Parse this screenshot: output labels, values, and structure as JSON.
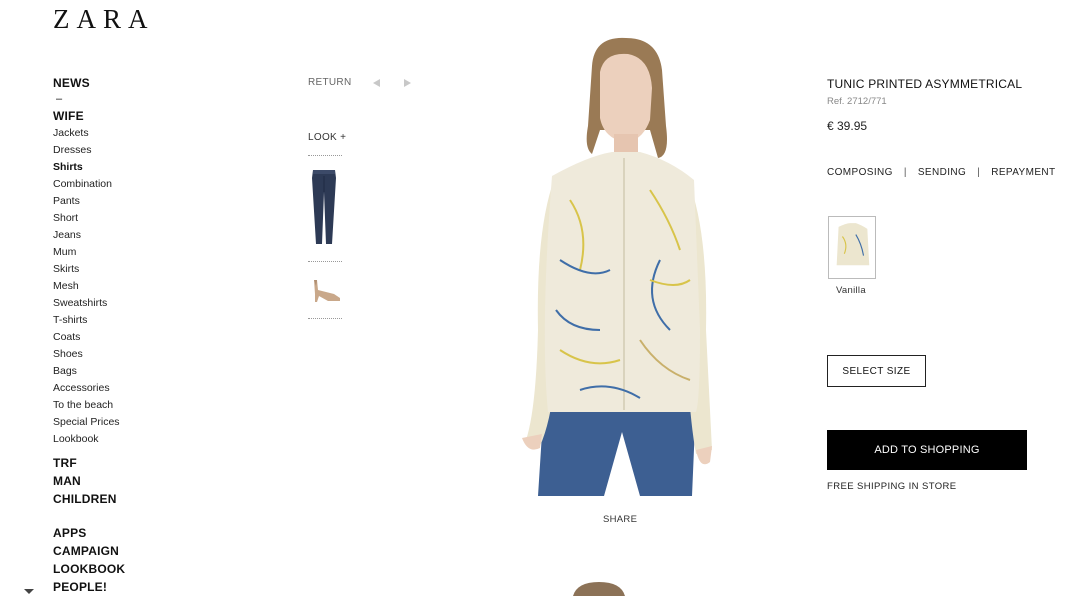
{
  "brand": {
    "logo_text": "ZARA"
  },
  "nav": {
    "news": "NEWS",
    "dash": "–",
    "wife": "WIFE",
    "wife_items": [
      {
        "label": "Jackets",
        "active": false
      },
      {
        "label": "Dresses",
        "active": false
      },
      {
        "label": "Shirts",
        "active": true
      },
      {
        "label": "Combination",
        "active": false
      },
      {
        "label": "Pants",
        "active": false
      },
      {
        "label": "Short",
        "active": false
      },
      {
        "label": "Jeans",
        "active": false
      },
      {
        "label": "Mum",
        "active": false
      },
      {
        "label": "Skirts",
        "active": false
      },
      {
        "label": "Mesh",
        "active": false
      },
      {
        "label": "Sweatshirts",
        "active": false
      },
      {
        "label": "T-shirts",
        "active": false
      },
      {
        "label": "Coats",
        "active": false
      },
      {
        "label": "Shoes",
        "active": false
      },
      {
        "label": "Bags",
        "active": false
      },
      {
        "label": "Accessories",
        "active": false
      },
      {
        "label": "To the beach",
        "active": false
      },
      {
        "label": "Special Prices",
        "active": false
      },
      {
        "label": "Lookbook",
        "active": false
      }
    ],
    "sections": [
      "TRF",
      "MAN",
      "CHILDREN"
    ],
    "extras": [
      "APPS",
      "CAMPAIGN",
      "LOOKBOOK",
      "PEOPLE!"
    ]
  },
  "look_panel": {
    "return_label": "RETURN",
    "look_label": "LOOK +",
    "items": [
      "jeans-icon",
      "heels-icon"
    ]
  },
  "product": {
    "title": "TUNIC PRINTED ASYMMETRICAL",
    "ref": "Ref. 2712/771",
    "price": "€ 39.95",
    "tabs": [
      "COMPOSING",
      "SENDING",
      "REPAYMENT"
    ],
    "tab_separator": "|",
    "color_name": "Vanilla",
    "select_size_label": "SELECT SIZE",
    "add_button_label": "ADD TO SHOPPING",
    "shipping_note": "FREE SHIPPING IN STORE",
    "share_label": "SHARE"
  },
  "colors": {
    "accent": "#000000",
    "text": "#222222",
    "muted": "#888888"
  }
}
